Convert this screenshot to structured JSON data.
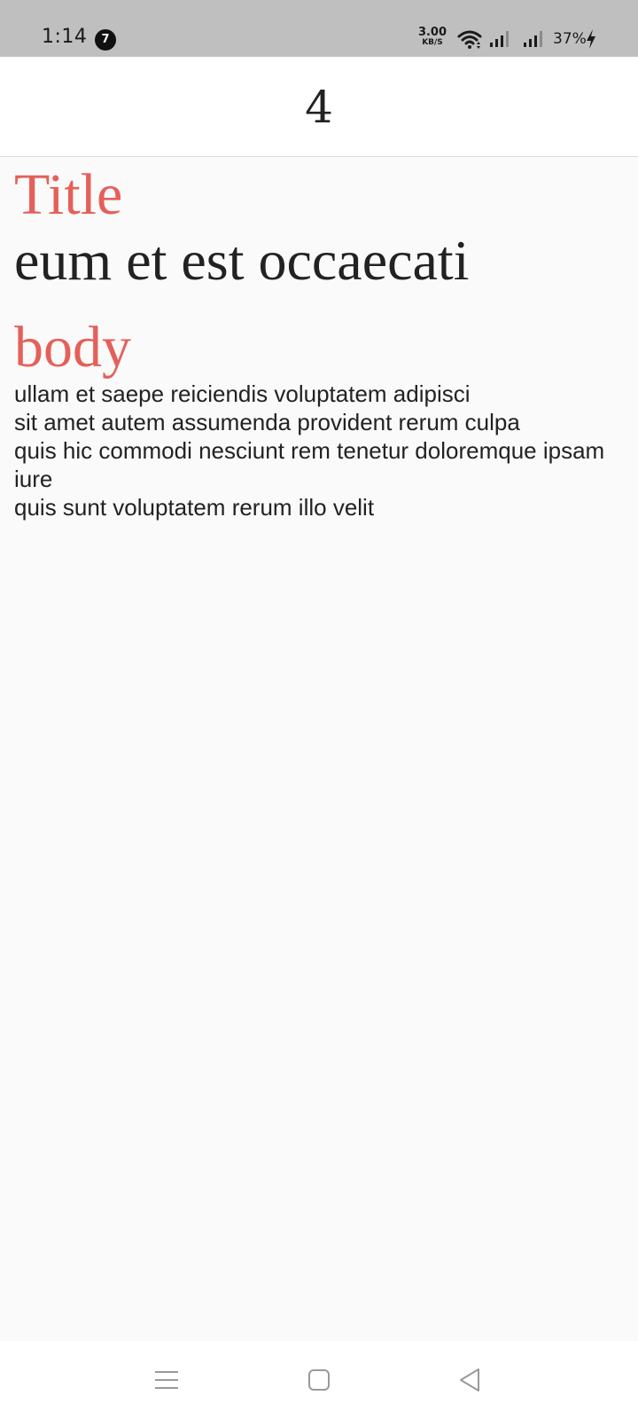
{
  "status_bar": {
    "time": "1:14",
    "notification_count": "7",
    "net_speed_value": "3.00",
    "net_speed_unit": "KB/S",
    "battery": "37%",
    "icons": [
      "wifi-icon",
      "signal-icon",
      "signal-icon",
      "charging-bolt-icon"
    ]
  },
  "app_bar": {
    "title": "4"
  },
  "post": {
    "title_label": "Title",
    "title": "eum et est occaecati",
    "body_label": "body",
    "body": "ullam et saepe reiciendis voluptatem adipisci\nsit amet autem assumenda provident rerum culpa\nquis hic commodi nesciunt rem tenetur doloremque ipsam iure\nquis sunt voluptatem rerum illo velit"
  },
  "nav_bar": {
    "icons": [
      "menu-icon",
      "home-icon",
      "back-icon"
    ]
  },
  "colors": {
    "accent": "#e5605a",
    "status_bar_bg": "#bfbfbf",
    "page_bg": "#fafafa",
    "text": "#222222"
  }
}
